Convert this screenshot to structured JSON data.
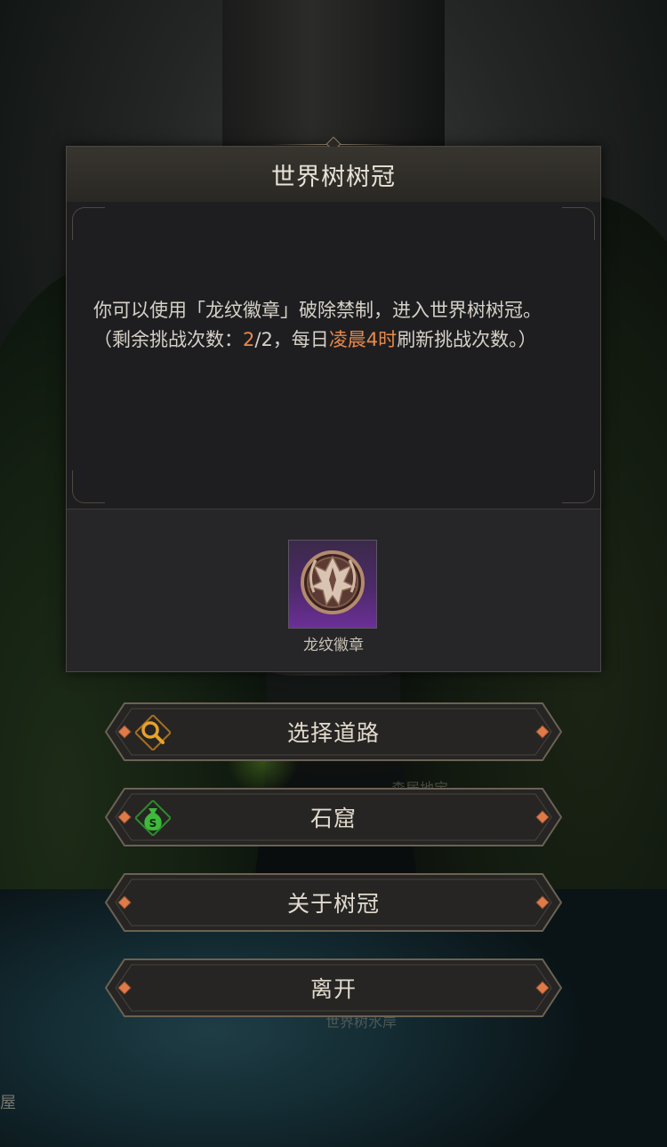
{
  "background": {
    "hidden_labels": [
      "森居地宝",
      "世界树水岸"
    ],
    "edge_label": "屋"
  },
  "dialog": {
    "title": "世界树树冠",
    "message": {
      "line1": "你可以使用「龙纹徽章」破除禁制，进入世界树树冠。",
      "line2_prefix": "（剩余挑战次数：",
      "remaining": "2",
      "line2_mid": "/2，每日",
      "reset_time": "凌晨4时",
      "line2_suffix": "刷新挑战次数。）"
    },
    "item": {
      "name": "龙纹徽章",
      "icon": "dragon-emblem-icon"
    }
  },
  "buttons": [
    {
      "label": "选择道路",
      "icon": "magnifier-icon"
    },
    {
      "label": "石窟",
      "icon": "money-bag-icon"
    },
    {
      "label": "关于树冠",
      "icon": null
    },
    {
      "label": "离开",
      "icon": null
    }
  ],
  "colors": {
    "highlight": "#e9894b",
    "dialog_bg": "#1d1d1f",
    "item_rarity": "#6b2f96",
    "button_gem": "#e07a48",
    "money_icon": "#3dbb3a",
    "magnifier_icon": "#e6a22c"
  }
}
